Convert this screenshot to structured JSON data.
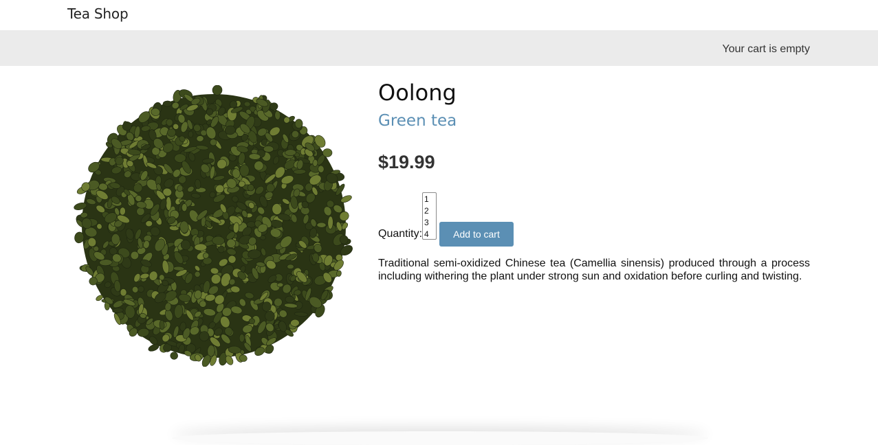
{
  "header": {
    "brand": "Tea Shop"
  },
  "cart": {
    "status": "Your cart is empty"
  },
  "product": {
    "image_icon": "loose-leaf-tea-image",
    "name": "Oolong",
    "category": "Green tea",
    "price": "$19.99",
    "quantity_label": "Quantity:",
    "quantity_options": [
      "1",
      "2",
      "3",
      "4"
    ],
    "add_to_cart_label": "Add to cart",
    "description": "Traditional semi-oxidized Chinese tea (Camellia sinensis) produced through a process including withering the plant under strong sun and oxidation before curling and twisting."
  },
  "colors": {
    "accent": "#5b8fb4",
    "cart_bar": "#ebebeb",
    "tea_dark": "#2f3a17",
    "tea_mid": "#4b5a24",
    "tea_light": "#6f7d33"
  }
}
